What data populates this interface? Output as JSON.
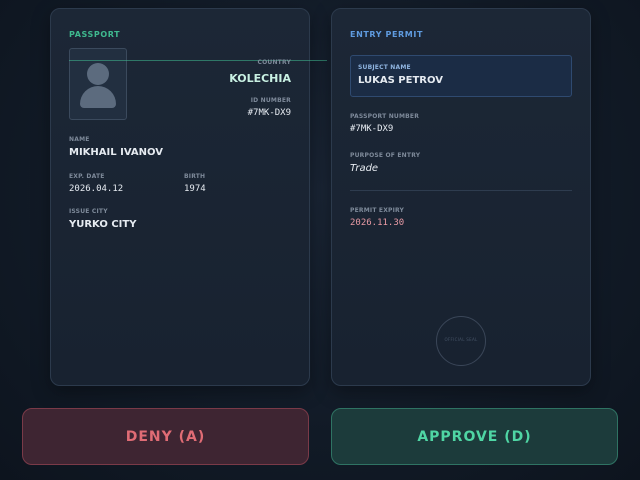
{
  "passport": {
    "title": "PASSPORT",
    "country_label": "COUNTRY",
    "country": "KOLECHIA",
    "id_label": "ID NUMBER",
    "id_number": "#7MK-DX9",
    "name_label": "NAME",
    "name": "MIKHAIL IVANOV",
    "exp_label": "EXP. DATE",
    "exp_date": "2026.04.12",
    "birth_label": "BIRTH",
    "birth": "1974",
    "city_label": "ISSUE CITY",
    "city": "YURKO CITY"
  },
  "permit": {
    "title": "ENTRY PERMIT",
    "subject_label": "SUBJECT NAME",
    "subject": "LUKAS PETROV",
    "passport_number_label": "PASSPORT NUMBER",
    "passport_number": "#7MK-DX9",
    "purpose_label": "PURPOSE OF ENTRY",
    "purpose": "Trade",
    "expiry_label": "PERMIT EXPIRY",
    "expiry": "2026.11.30",
    "seal_text": "OFFICIAL SEAL"
  },
  "actions": {
    "deny": "DENY (A)",
    "approve": "APPROVE (D)"
  },
  "colors": {
    "passport_accent": "#3fb98f",
    "permit_accent": "#5f9be0",
    "country_text": "#c8f0e2",
    "expiry_text": "#e89aa4",
    "deny": "#e06c75",
    "approve": "#4fd6a4"
  }
}
